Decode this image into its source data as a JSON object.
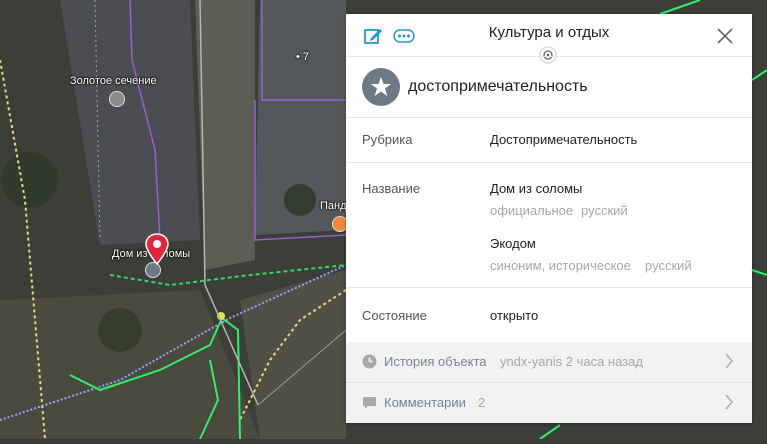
{
  "map": {
    "labels": {
      "zolotoe": "Золотое сечение",
      "dom": "Дом из соломы",
      "pand": "Панд",
      "house_number": "• 7"
    }
  },
  "panel": {
    "title": "Культура и отдых",
    "object_name": "достопримечательность",
    "rubric_label": "Рубрика",
    "rubric_value": "Достопримечательность",
    "name_label": "Название",
    "names": [
      {
        "value": "Дом из соломы",
        "type": "официальное",
        "lang": "русский"
      },
      {
        "value": "Экодом",
        "type": "синоним, историческое",
        "lang": "русский"
      }
    ],
    "state_label": "Состояние",
    "state_value": "открыто",
    "history_label": "История объекта",
    "history_meta": "yndx-yanis 2 часа назад",
    "comments_label": "Комментарии",
    "comments_count": "2"
  },
  "colors": {
    "accent": "#1e98d4",
    "object_icon_bg": "#6d7a86",
    "pin_red": "#e0263a"
  }
}
